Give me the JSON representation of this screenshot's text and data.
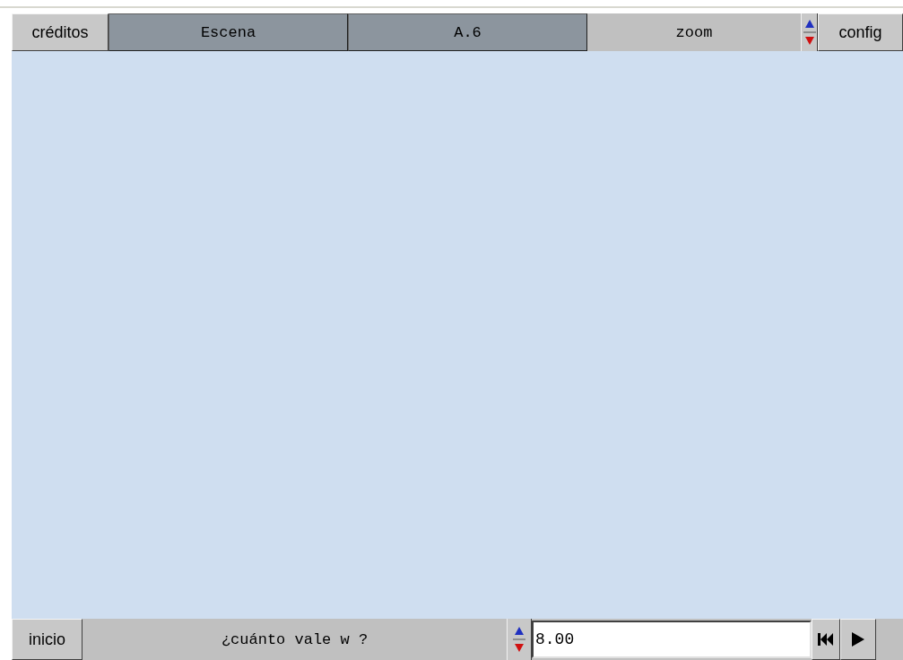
{
  "top_bar": {
    "credits_button": "créditos",
    "scene_labels": [
      "Escena",
      "A.6"
    ],
    "zoom_control": {
      "label": "zoom"
    },
    "config_button": "config"
  },
  "bottom_bar": {
    "start_button": "inicio",
    "question": "¿cuánto vale w ?",
    "answer_field": {
      "value": "8.00"
    },
    "buttons": [
      {
        "kind": "rewind"
      },
      {
        "kind": "play"
      }
    ]
  }
}
